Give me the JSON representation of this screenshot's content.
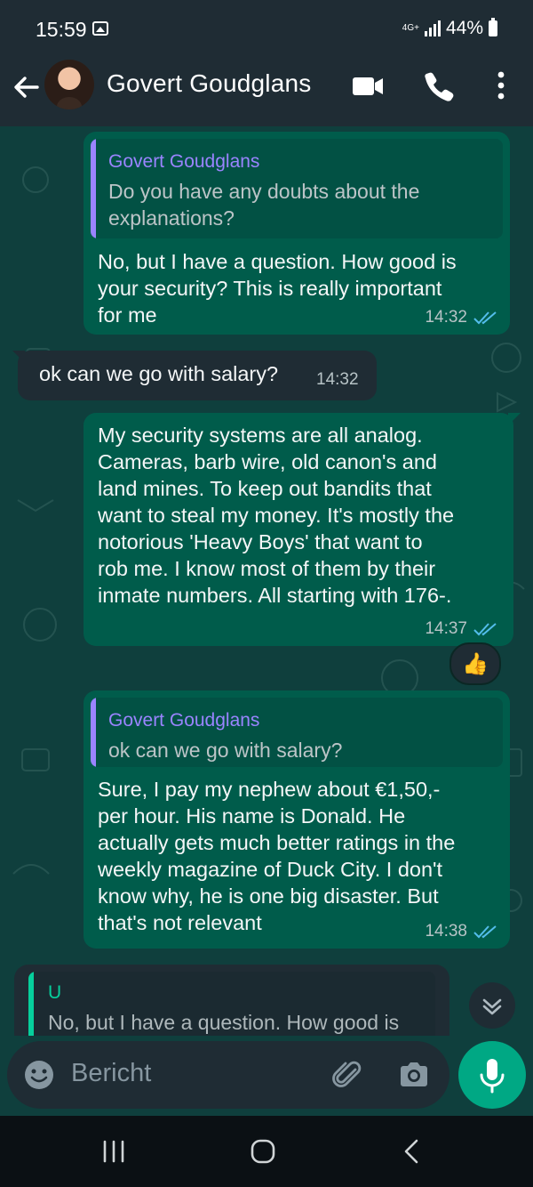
{
  "status": {
    "time": "15:59",
    "network": "4G+",
    "battery": "44%"
  },
  "header": {
    "contact_name": "Govert Goudglans"
  },
  "messages": [
    {
      "quote_author": "Govert Goudglans",
      "quote_text": "Do you have any doubts about the\nexplanations?",
      "text": "No, but I have a question. How good is\nyour security? This is really important\nfor me",
      "time": "14:32"
    },
    {
      "text": "ok can we go with salary?",
      "time": "14:32"
    },
    {
      "text": "My security systems are all analog.\nCameras, barb wire, old canon's and\nland mines. To keep out bandits that\nwant to steal my money. It's mostly the\nnotorious 'Heavy Boys' that want to\nrob me. I know most of them by their\ninmate numbers. All starting with 176-.",
      "time": "14:37",
      "reaction": "👍"
    },
    {
      "quote_author": "Govert Goudglans",
      "quote_text": "ok can we go with salary?",
      "text": "Sure, I pay my nephew about €1,50,-\nper hour. His name is Donald. He\nactually gets much better ratings in the\nweekly magazine of Duck City. I don't\nknow why, he is one big disaster. But\nthat's not relevant",
      "time": "14:38"
    }
  ],
  "reply_preview": {
    "author": "U",
    "text": "No, but I have a question. How good is"
  },
  "composer": {
    "placeholder": "Bericht"
  },
  "colors": {
    "outgoing_bubble": "#005c4b",
    "incoming_bubble": "#1f2c34",
    "quote_author": "#9a84ff",
    "read_tick": "#53bdeb",
    "accent": "#00a884"
  },
  "icons": [
    "back-arrow-icon",
    "video-call-icon",
    "phone-icon",
    "more-vert-icon",
    "double-check-icon",
    "chevron-double-down-icon",
    "emoji-icon",
    "attach-icon",
    "camera-icon",
    "mic-icon",
    "recent-apps-icon",
    "home-icon",
    "back-nav-icon"
  ]
}
